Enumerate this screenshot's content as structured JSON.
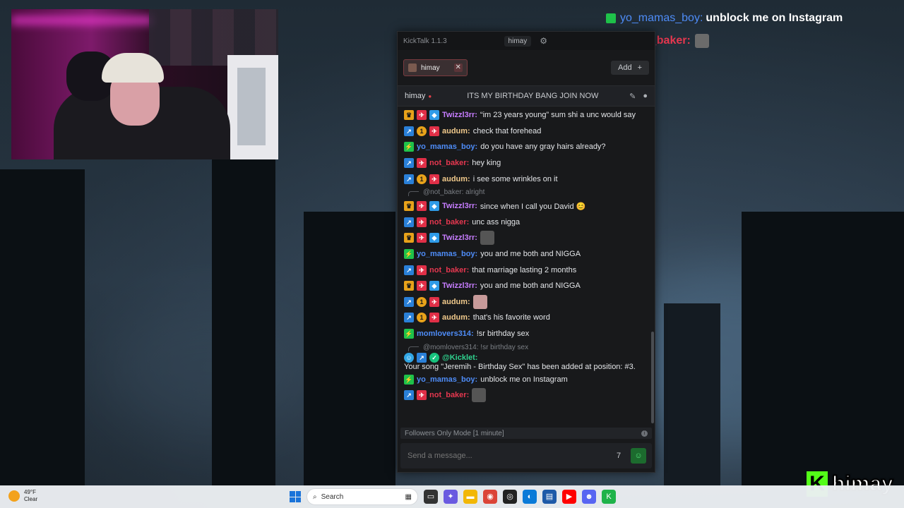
{
  "overlay": {
    "rows": [
      {
        "user": "yo_mamas_boy:",
        "text": "unblock me on Instagram",
        "user_color": "#4e8cf7"
      },
      {
        "user": "not_baker:",
        "text": "",
        "user_color": "#e5374f"
      }
    ]
  },
  "app": {
    "title": "KickTalk 1.1.3",
    "account": "himay",
    "settings_icon": "gear-icon"
  },
  "tabs": [
    {
      "label": "himay"
    }
  ],
  "add_button": {
    "label": "Add",
    "icon": "plus-icon"
  },
  "channel_header": {
    "name": "himay",
    "stream_title": "ITS MY BIRTHDAY BANG JOIN NOW"
  },
  "messages": [
    {
      "badges": [
        "crown",
        "rkt",
        "cube"
      ],
      "user": "Twizzl3rr:",
      "color": "pink",
      "text": "“im 23 years young” sum shi a unc would say"
    },
    {
      "badges": [
        "blue",
        "one",
        "rkt"
      ],
      "user": "audum:",
      "color": "gold",
      "text": "check that forehead"
    },
    {
      "badges": [
        "green"
      ],
      "user": "yo_mamas_boy:",
      "color": "blue",
      "text": "do you have any gray hairs already?"
    },
    {
      "badges": [
        "blue",
        "rkt"
      ],
      "user": "not_baker:",
      "color": "red",
      "text": "hey king"
    },
    {
      "badges": [
        "blue",
        "one",
        "rkt"
      ],
      "user": "audum:",
      "color": "gold",
      "text": "i see some wrinkles on it"
    },
    {
      "reply": "@not_baker: alright"
    },
    {
      "badges": [
        "crown",
        "rkt",
        "cube"
      ],
      "user": "Twizzl3rr:",
      "color": "pink",
      "text": "since when I call you David 😊"
    },
    {
      "badges": [
        "blue",
        "rkt"
      ],
      "user": "not_baker:",
      "color": "red",
      "text": "unc ass nigga"
    },
    {
      "badges": [
        "crown",
        "rkt",
        "cube"
      ],
      "user": "Twizzl3rr:",
      "color": "pink",
      "text": "",
      "emote": true
    },
    {
      "badges": [
        "green"
      ],
      "user": "yo_mamas_boy:",
      "color": "blue",
      "text": "you and me both and NIGGA"
    },
    {
      "badges": [
        "blue",
        "rkt"
      ],
      "user": "not_baker:",
      "color": "red",
      "text": "that marriage lasting 2 months"
    },
    {
      "badges": [
        "crown",
        "rkt",
        "cube"
      ],
      "user": "Twizzl3rr:",
      "color": "pink",
      "text": "you and me both and NIGGA"
    },
    {
      "badges": [
        "blue",
        "one",
        "rkt"
      ],
      "user": "audum:",
      "color": "gold",
      "text": "",
      "emote": true
    },
    {
      "badges": [
        "blue",
        "one",
        "rkt"
      ],
      "user": "audum:",
      "color": "gold",
      "text": "that's his favorite word"
    },
    {
      "badges": [
        "green"
      ],
      "user": "momlovers314:",
      "color": "blue",
      "text": "!sr birthday sex"
    },
    {
      "reply": "@momlovers314: !sr birthday sex"
    },
    {
      "badges": [
        "bot",
        "blue",
        "ver"
      ],
      "user": "@Kicklet:",
      "color": "teal",
      "text": "Your song \"Jeremih - Birthday Sex\" has been added at position: #3."
    },
    {
      "badges": [
        "green"
      ],
      "user": "yo_mamas_boy:",
      "color": "blue",
      "text": "unblock me on Instagram"
    },
    {
      "badges": [
        "blue",
        "rkt"
      ],
      "user": "not_baker:",
      "color": "red",
      "text": "",
      "emote": true
    }
  ],
  "followers_only": "Followers Only Mode [1 minute]",
  "input": {
    "placeholder": "Send a message..."
  },
  "brand": {
    "kick_letter": "K",
    "name": "himay",
    "accent": "#53fc18"
  },
  "taskbar": {
    "weather_temp": "49°F",
    "weather_desc": "Clear",
    "search_label": "Search"
  }
}
